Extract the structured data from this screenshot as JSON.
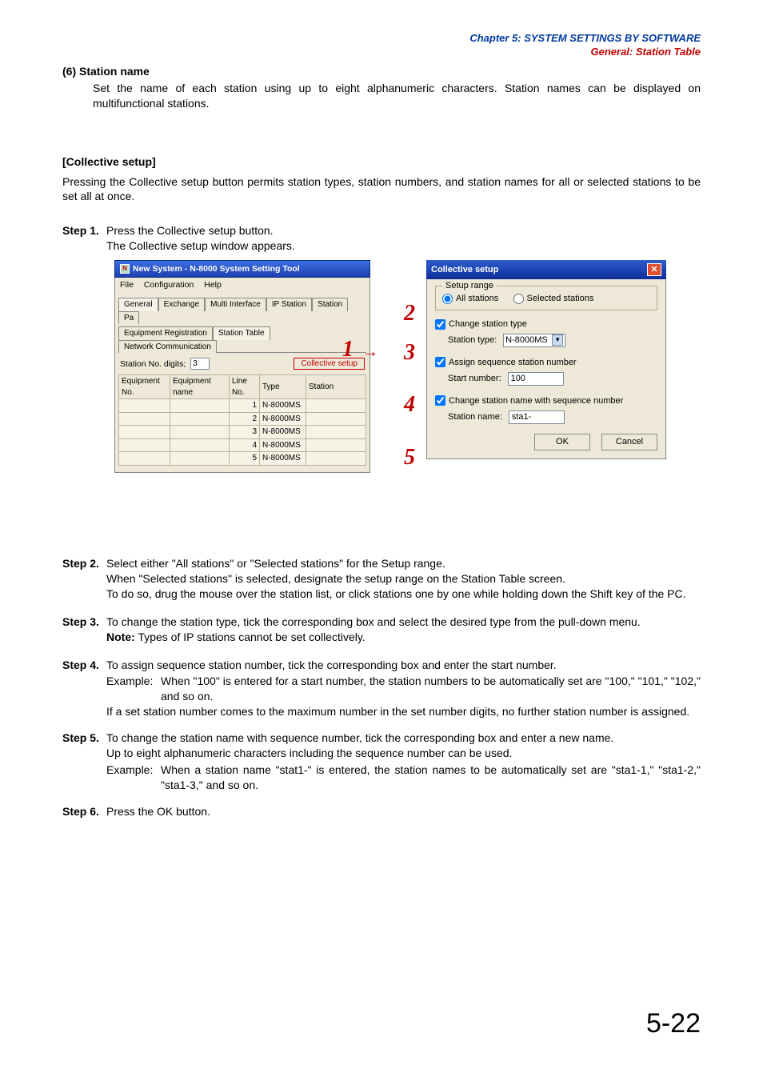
{
  "header": {
    "chapter": "Chapter 5:  SYSTEM SETTINGS BY SOFTWARE",
    "subtitle": "General: Station Table"
  },
  "section6": {
    "title": "(6)  Station name",
    "body": "Set the name of each station using up to eight alphanumeric characters. Station names can be displayed on multifunctional stations."
  },
  "collective": {
    "heading": "[Collective setup]",
    "intro": "Pressing the Collective setup button permits station types, station numbers, and station names for all or selected stations to be set all at once."
  },
  "step1": {
    "label": "Step 1.",
    "line1": "Press the Collective setup button.",
    "line2": "The Collective setup window appears."
  },
  "win1": {
    "title": "New System - N-8000 System Setting Tool",
    "menu": {
      "file": "File",
      "config": "Configuration",
      "help": "Help"
    },
    "tabs": {
      "general": "General",
      "exchange": "Exchange",
      "multi": "Multi Interface",
      "ip": "IP Station",
      "station": "Station",
      "pa": "Pa"
    },
    "subtabs": {
      "equipreg": "Equipment Registration",
      "stationtable": "Station Table",
      "netcomm": "Network Communication"
    },
    "digits_label": "Station No. digits;",
    "digits_value": "3",
    "collective_btn": "Collective setup",
    "cols": {
      "equipno": "Equipment No.",
      "equipname": "Equipment name",
      "lineno": "Line No.",
      "type": "Type",
      "station": "Station"
    },
    "rows": [
      {
        "lineno": "1",
        "type": "N-8000MS"
      },
      {
        "lineno": "2",
        "type": "N-8000MS"
      },
      {
        "lineno": "3",
        "type": "N-8000MS"
      },
      {
        "lineno": "4",
        "type": "N-8000MS"
      },
      {
        "lineno": "5",
        "type": "N-8000MS"
      }
    ]
  },
  "win2": {
    "title": "Collective setup",
    "group_legend": "Setup range",
    "radio_all": "All stations",
    "radio_sel": "Selected stations",
    "chk_type": "Change station type",
    "type_label": "Station type:",
    "type_value": "N-8000MS",
    "chk_seq": "Assign sequence station number",
    "start_label": "Start number:",
    "start_value": "100",
    "chk_name": "Change station name with sequence number",
    "name_label": "Station name:",
    "name_value": "sta1-",
    "ok": "OK",
    "cancel": "Cancel"
  },
  "nums": {
    "n1": "1",
    "n2": "2",
    "n3": "3",
    "n4": "4",
    "n5": "5"
  },
  "step2": {
    "label": "Step 2.",
    "l1": "Select either \"All stations\" or \"Selected stations\" for the Setup range.",
    "l2": "When \"Selected stations\" is selected, designate the setup range on the Station Table screen.",
    "l3": "To do so, drug the mouse over the station list, or click stations one by one while holding down the Shift key of the PC."
  },
  "step3": {
    "label": "Step 3.",
    "l1": "To change the station type, tick the corresponding box and select the desired type from the pull-down menu.",
    "note_label": "Note:",
    "note_body": " Types of IP stations cannot be set collectively."
  },
  "step4": {
    "label": "Step 4.",
    "l1": "To assign sequence station number, tick the corresponding box and enter the start number.",
    "ex_label": "Example:",
    "ex_body": "When \"100\" is entered for a start number, the station numbers to be automatically set are \"100,\" \"101,\" \"102,\" and so on.",
    "l2": "If a set station number comes to the maximum number in the set number digits, no further station number is assigned."
  },
  "step5": {
    "label": "Step 5.",
    "l1": "To change the station name with sequence number, tick the corresponding box and enter a new name.",
    "l2": "Up to eight alphanumeric characters including the sequence number can be used.",
    "ex_label": "Example:",
    "ex_body": "When a station name \"stat1-\" is entered, the station names to be automatically set are \"sta1-1,\" \"sta1-2,\" \"sta1-3,\" and so on."
  },
  "step6": {
    "label": "Step 6.",
    "l1": "Press the OK button."
  },
  "page_number": "5-22"
}
